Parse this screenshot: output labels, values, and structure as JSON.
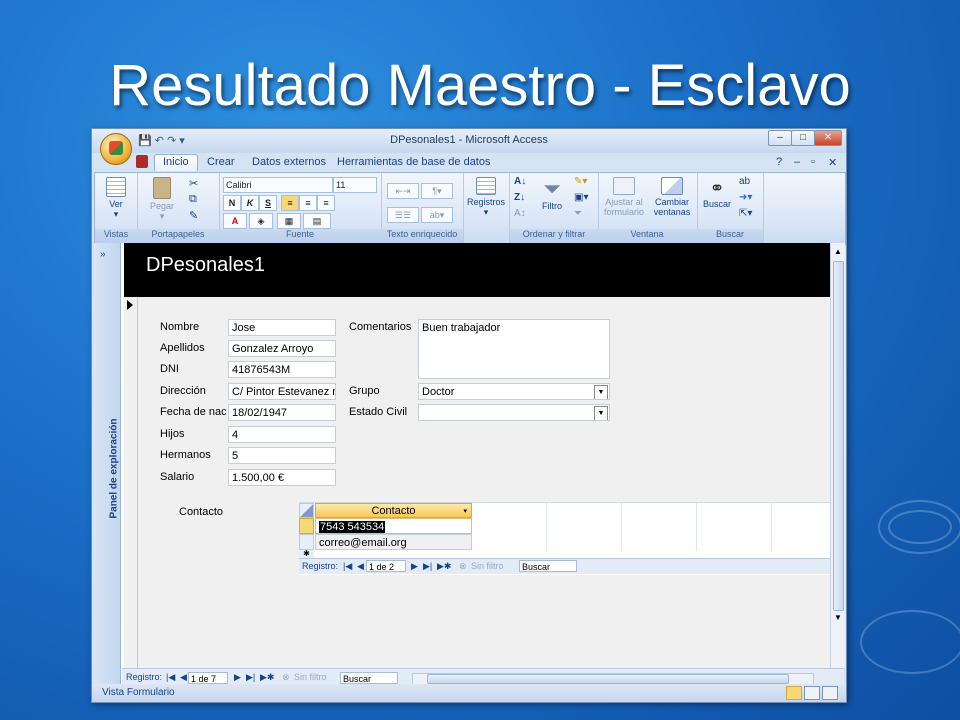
{
  "slide": {
    "title": "Resultado Maestro - Esclavo"
  },
  "window": {
    "title": "DPesonales1 - Microsoft Access",
    "tabs": [
      "Inicio",
      "Crear",
      "Datos externos",
      "Herramientas de base de datos"
    ],
    "controls": {
      "minimize": "–",
      "maximize": "□",
      "close": "✕"
    }
  },
  "ribbon": {
    "groups": [
      "Vistas",
      "Portapapeles",
      "Fuente",
      "Texto enriquecido",
      "Ordenar y filtrar",
      "Ventana",
      "Buscar"
    ],
    "ver_label": "Ver",
    "pegar_label": "Pegar",
    "font_name": "Calibri",
    "font_size": "11",
    "bold": "N",
    "italic": "K",
    "underline": "S",
    "registros_label": "Registros",
    "filtro_label": "Filtro",
    "ajustar_label": "Ajustar al formulario",
    "cambiar_label": "Cambiar ventanas",
    "buscar_label": "Buscar"
  },
  "nav_pane": {
    "label": "Panel de exploración",
    "expand": "»"
  },
  "form": {
    "header": "DPesonales1",
    "fields": [
      {
        "label": "Nombre",
        "value": "Jose"
      },
      {
        "label": "Apellidos",
        "value": "Gonzalez Arroyo"
      },
      {
        "label": "DNI",
        "value": "41876543M"
      },
      {
        "label": "Dirección",
        "value": "C/ Pintor Estevanez n"
      },
      {
        "label": "Fecha de naci",
        "value": "18/02/1947"
      },
      {
        "label": "Hijos",
        "value": "4"
      },
      {
        "label": "Hermanos",
        "value": "5"
      },
      {
        "label": "Salario",
        "value": "1.500,00 €"
      }
    ],
    "comentarios": {
      "label": "Comentarios",
      "value": "Buen trabajador"
    },
    "grupo": {
      "label": "Grupo",
      "value": "Doctor"
    },
    "estado_civil": {
      "label": "Estado Civil",
      "value": ""
    },
    "contacto": {
      "label": "Contacto",
      "column": "Contacto",
      "rows": [
        "7543 543534",
        "correo@email.org"
      ],
      "new_row_marker": "✱",
      "nav": {
        "registro": "Registro:",
        "position": "1 de 2",
        "filter": "Sin filtro",
        "search": "Buscar"
      }
    }
  },
  "main_nav": {
    "registro": "Registro:",
    "position": "1 de 7",
    "filter": "Sin filtro",
    "search": "Buscar"
  },
  "status": {
    "text": "Vista Formulario"
  }
}
